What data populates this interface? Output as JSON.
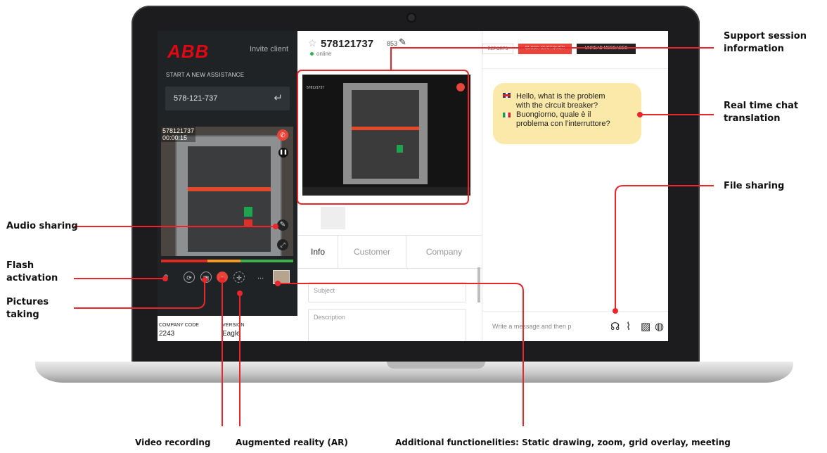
{
  "annotations": {
    "support_session": "Support session\ninformation",
    "realtime_chat": "Real time chat\ntranslation",
    "file_sharing": "File sharing",
    "audio_sharing": "Audio sharing",
    "flash_activation": "Flash\nactivation",
    "pictures_taking": "Pictures\ntaking",
    "video_recording": "Video recording",
    "augmented_reality": "Augmented reality (AR)",
    "additional": "Additional functionelities: Static drawing, zoom, grid overlay, meeting"
  },
  "left_panel": {
    "logo": "ABB",
    "invite": "Invite client",
    "start_label": "START A NEW ASSISTANCE",
    "code_value": "578-121-737",
    "return_glyph": "↵",
    "video_id": "578121737",
    "video_time": "00:00:15",
    "more_glyph": "...",
    "company_code_label": "COMPANY CODE",
    "company_code_value": "2243",
    "version_label": "VERSION",
    "version_value": "Eagle"
  },
  "session": {
    "star_glyph": "☆",
    "id": "578121737",
    "sub": "853",
    "edit_glyph": "✎",
    "status": "online"
  },
  "tabs": [
    {
      "label": "Info"
    },
    {
      "label": "Customer"
    },
    {
      "label": "Company"
    }
  ],
  "form": {
    "subject_placeholder": "Subject",
    "description_placeholder": "Description"
  },
  "chat": {
    "reports": "REPORTS",
    "block": "BLOCK CUSTOMER",
    "unread": "UNREAD MESSAGES",
    "msg_en_1": "Hello, what is the problem",
    "msg_en_2": "with the  circuit breaker?",
    "msg_it_1": "Buongiorno, quale è il",
    "msg_it_2": "problema con l'interruttore?",
    "input_placeholder": "Write a message and then p"
  },
  "colors": {
    "accent_red": "#e30613",
    "annotation_red": "#e8262c",
    "bubble": "#fbe9a9",
    "panel_dark": "#1f2326"
  }
}
